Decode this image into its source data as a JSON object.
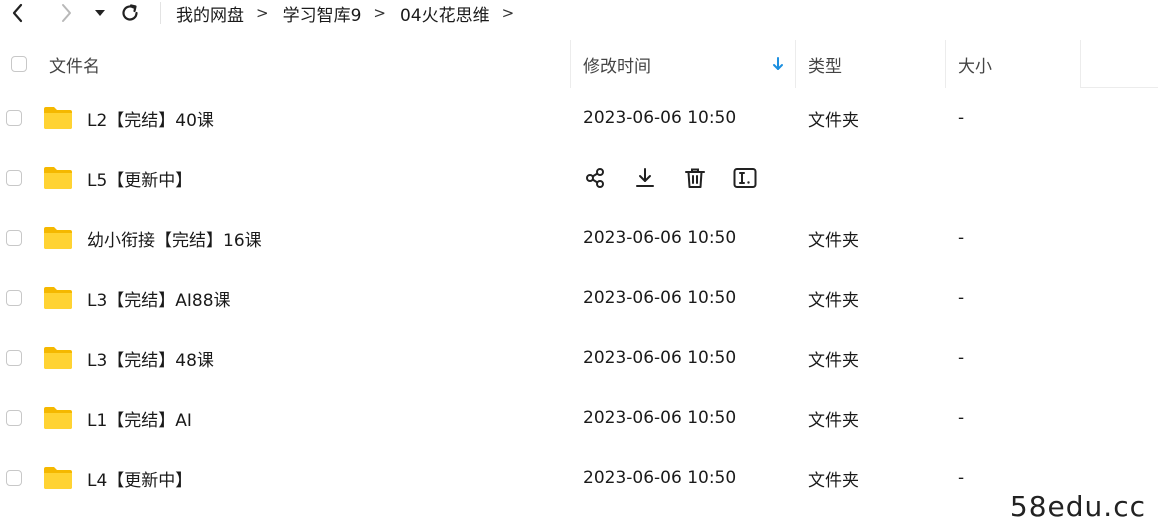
{
  "toolbar": {
    "back_icon": "chevron-left-icon",
    "forward_icon": "chevron-right-icon",
    "history_icon": "caret-down-icon",
    "refresh_icon": "refresh-icon"
  },
  "breadcrumb": {
    "items": [
      "我的网盘",
      "学习智库9",
      "04火花思维"
    ],
    "separator": ">"
  },
  "columns": {
    "name": "文件名",
    "modified": "修改时间",
    "type": "类型",
    "size": "大小",
    "sort_icon": "arrow-down-icon",
    "sort_color": "#1c8fe0"
  },
  "folder_color": "#ffcc33",
  "rows": [
    {
      "name": "L2【完结】40课",
      "modified": "2023-06-06 10:50",
      "type": "文件夹",
      "size": "-"
    },
    {
      "name": "L5【更新中】",
      "modified": "",
      "type": "",
      "size": ""
    },
    {
      "name": "幼小衔接【完结】16课",
      "modified": "2023-06-06 10:50",
      "type": "文件夹",
      "size": "-"
    },
    {
      "name": "L3【完结】AI88课",
      "modified": "2023-06-06 10:50",
      "type": "文件夹",
      "size": "-"
    },
    {
      "name": "L3【完结】48课",
      "modified": "2023-06-06 10:50",
      "type": "文件夹",
      "size": "-"
    },
    {
      "name": "L1【完结】AI",
      "modified": "2023-06-06 10:50",
      "type": "文件夹",
      "size": "-"
    },
    {
      "name": "L4【更新中】",
      "modified": "2023-06-06 10:50",
      "type": "文件夹",
      "size": "-"
    }
  ],
  "hover_actions": [
    "share-icon",
    "download-icon",
    "delete-icon",
    "rename-icon"
  ],
  "watermark": "58edu.cc"
}
